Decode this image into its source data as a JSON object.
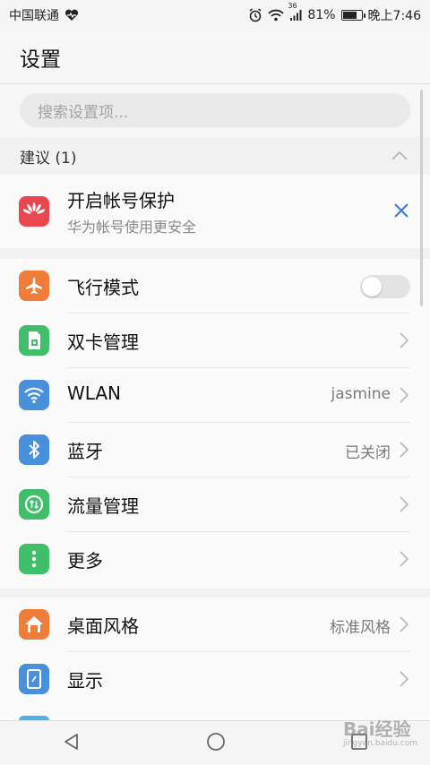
{
  "status_bar": {
    "carrier": "中国联通",
    "network": "36",
    "battery_percent": "81%",
    "battery_level": 0.81,
    "time": "晚上7:46"
  },
  "header": {
    "title": "设置"
  },
  "search": {
    "placeholder": "搜索设置项..."
  },
  "suggestions": {
    "heading": "建议 (1)",
    "card": {
      "title": "开启帐号保护",
      "subtitle": "华为帐号使用更安全",
      "icon": "huawei-logo-icon"
    }
  },
  "group1": {
    "items": [
      {
        "label": "飞行模式",
        "icon": "airplane-icon",
        "color": "#f07c3a",
        "toggle": false
      },
      {
        "label": "双卡管理",
        "icon": "sim-card-icon",
        "color": "#3fbf6a"
      },
      {
        "label": "WLAN",
        "icon": "wifi-icon",
        "color": "#4a8fd9",
        "value": "jasmine"
      },
      {
        "label": "蓝牙",
        "icon": "bluetooth-icon",
        "color": "#4a8fd9",
        "value": "已关闭"
      },
      {
        "label": "流量管理",
        "icon": "data-usage-icon",
        "color": "#3fbf6a"
      },
      {
        "label": "更多",
        "icon": "more-vertical-icon",
        "color": "#3fbf6a"
      }
    ]
  },
  "group2": {
    "items": [
      {
        "label": "桌面风格",
        "icon": "home-icon",
        "color": "#f07c3a",
        "value": "标准风格"
      },
      {
        "label": "显示",
        "icon": "display-icon",
        "color": "#4a8fd9"
      }
    ]
  },
  "watermark": {
    "text": "Bai经验",
    "sub": "jingyan.baidu.com"
  }
}
